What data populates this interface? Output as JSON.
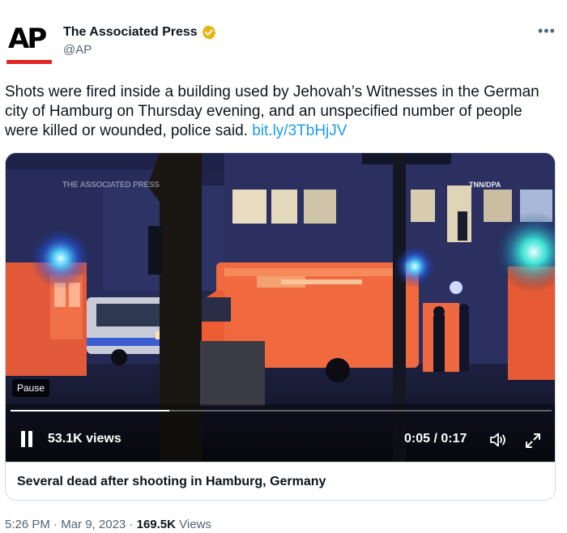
{
  "author": {
    "display_name": "The Associated Press",
    "handle": "@AP",
    "avatar_text": "AP",
    "verified_color": "#e2b719"
  },
  "tweet": {
    "text": "Shots were fired inside a building used by Jehovah’s Witnesses in the German city of Hamburg on Thursday evening, and an unspecified number of people were killed or wounded, police said.",
    "link": "bit.ly/3TbHjJV"
  },
  "video": {
    "watermark_left": "THE ASSOCIATED PRESS",
    "watermark_right": "TNN/DPA",
    "pause_label": "Pause",
    "views": "53.1K views",
    "time": "0:05 / 0:17",
    "progress_fraction": 0.294
  },
  "card": {
    "caption": "Several dead after shooting in Hamburg, Germany"
  },
  "meta": {
    "time": "5:26 PM",
    "date": "Mar 9, 2023",
    "views_count": "169.5K",
    "views_label": "Views"
  },
  "colors": {
    "link": "#1d9bf0",
    "brand_red": "#e32623",
    "secondary_text": "#536471"
  }
}
